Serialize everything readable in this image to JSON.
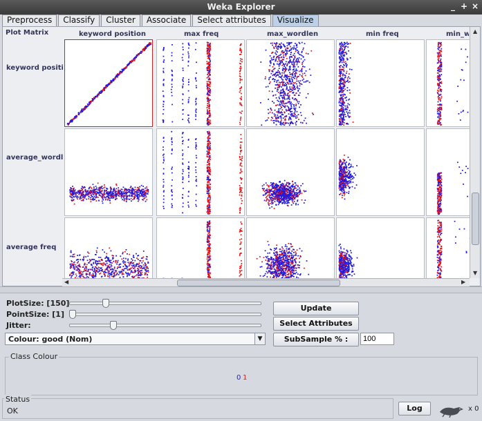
{
  "window": {
    "title": "Weka Explorer",
    "min_glyph": "_",
    "max_glyph": "+",
    "close_glyph": "×"
  },
  "tabs": [
    {
      "label": "Preprocess",
      "active": false
    },
    {
      "label": "Classify",
      "active": false
    },
    {
      "label": "Cluster",
      "active": false
    },
    {
      "label": "Associate",
      "active": false
    },
    {
      "label": "Select attributes",
      "active": false
    },
    {
      "label": "Visualize",
      "active": true
    }
  ],
  "matrix": {
    "title": "Plot Matrix",
    "columns": [
      "keyword position",
      "max freq",
      "max_wordlen",
      "min freq",
      "min_wo"
    ],
    "rows": [
      "keyword positio",
      "average_wordle",
      "average freq"
    ],
    "colors": {
      "class0": "#1f18e0",
      "class1": "#e81414"
    }
  },
  "controls": {
    "plot_size_label": "PlotSize: [150]",
    "point_size_label": "PointSize: [1]",
    "jitter_label": "Jitter:",
    "plot_size_level": 0.18,
    "point_size_level": 0.0,
    "jitter_level": 0.22,
    "colour_select": "Colour: good  (Nom)",
    "update_button": "Update",
    "select_attributes_button": "Select Attributes",
    "subsample_button": "SubSample % :",
    "subsample_value": "100"
  },
  "class_colour": {
    "title": "Class Colour",
    "items": [
      {
        "label": "0",
        "color": "#1f18e0"
      },
      {
        "label": "1",
        "color": "#e81414"
      }
    ]
  },
  "status": {
    "title": "Status",
    "text": "OK",
    "log_button": "Log",
    "task_count": "x 0",
    "bird_icon": "weka-bird-icon"
  }
}
